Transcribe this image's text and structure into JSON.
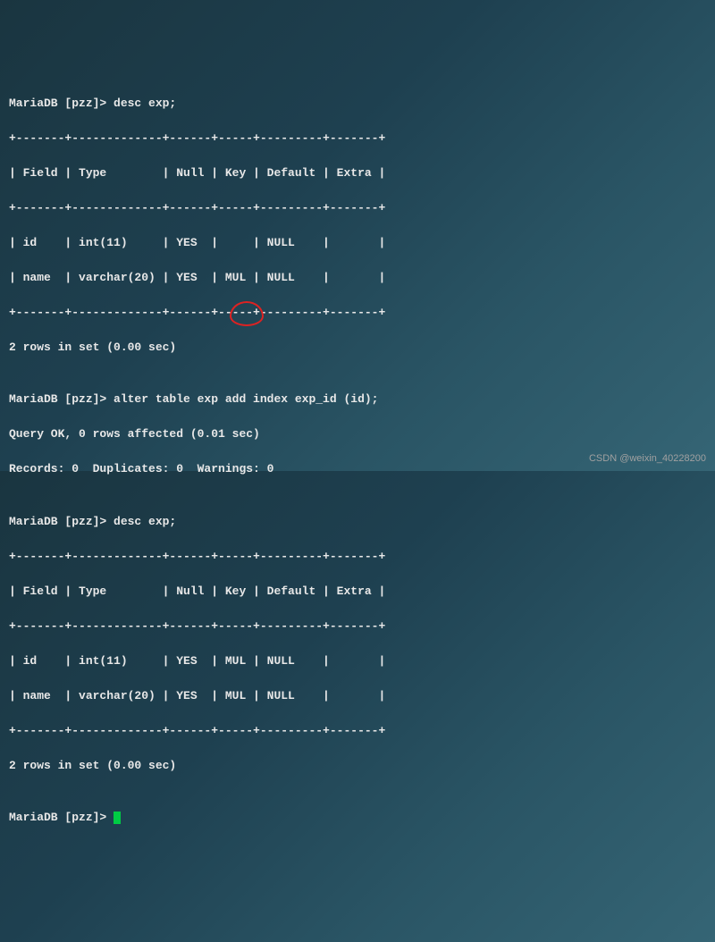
{
  "prompt1": "MariaDB [pzz]> desc exp;",
  "tsep": "+-------+-------------+------+-----+---------+-------+",
  "thead": "| Field | Type        | Null | Key | Default | Extra |",
  "t1r1": "| id    | int(11)     | YES  |     | NULL    |       |",
  "t1r2": "| name  | varchar(20) | YES  | MUL | NULL    |       |",
  "result1": "2 rows in set (0.00 sec)",
  "blank": "",
  "prompt2": "MariaDB [pzz]> alter table exp add index exp_id (id);",
  "result2a": "Query OK, 0 rows affected (0.01 sec)",
  "result2b": "Records: 0  Duplicates: 0  Warnings: 0",
  "prompt3": "MariaDB [pzz]> desc exp;",
  "t2r1": "| id    | int(11)     | YES  | MUL | NULL    |       |",
  "t2r2": "| name  | varchar(20) | YES  | MUL | NULL    |       |",
  "result3": "2 rows in set (0.00 sec)",
  "prompt4": "MariaDB [pzz]> ",
  "watermark": "CSDN @weixin_40228200",
  "chart_data": {
    "type": "table",
    "title": "desc exp (before and after adding index exp_id on id)",
    "columns": [
      "Field",
      "Type",
      "Null",
      "Key",
      "Default",
      "Extra"
    ],
    "before": [
      {
        "Field": "id",
        "Type": "int(11)",
        "Null": "YES",
        "Key": "",
        "Default": "NULL",
        "Extra": ""
      },
      {
        "Field": "name",
        "Type": "varchar(20)",
        "Null": "YES",
        "Key": "MUL",
        "Default": "NULL",
        "Extra": ""
      }
    ],
    "after": [
      {
        "Field": "id",
        "Type": "int(11)",
        "Null": "YES",
        "Key": "MUL",
        "Default": "NULL",
        "Extra": ""
      },
      {
        "Field": "name",
        "Type": "varchar(20)",
        "Null": "YES",
        "Key": "MUL",
        "Default": "NULL",
        "Extra": ""
      }
    ],
    "commands": [
      "desc exp;",
      "alter table exp add index exp_id (id);",
      "desc exp;"
    ],
    "db_prompt": "MariaDB [pzz]>"
  }
}
